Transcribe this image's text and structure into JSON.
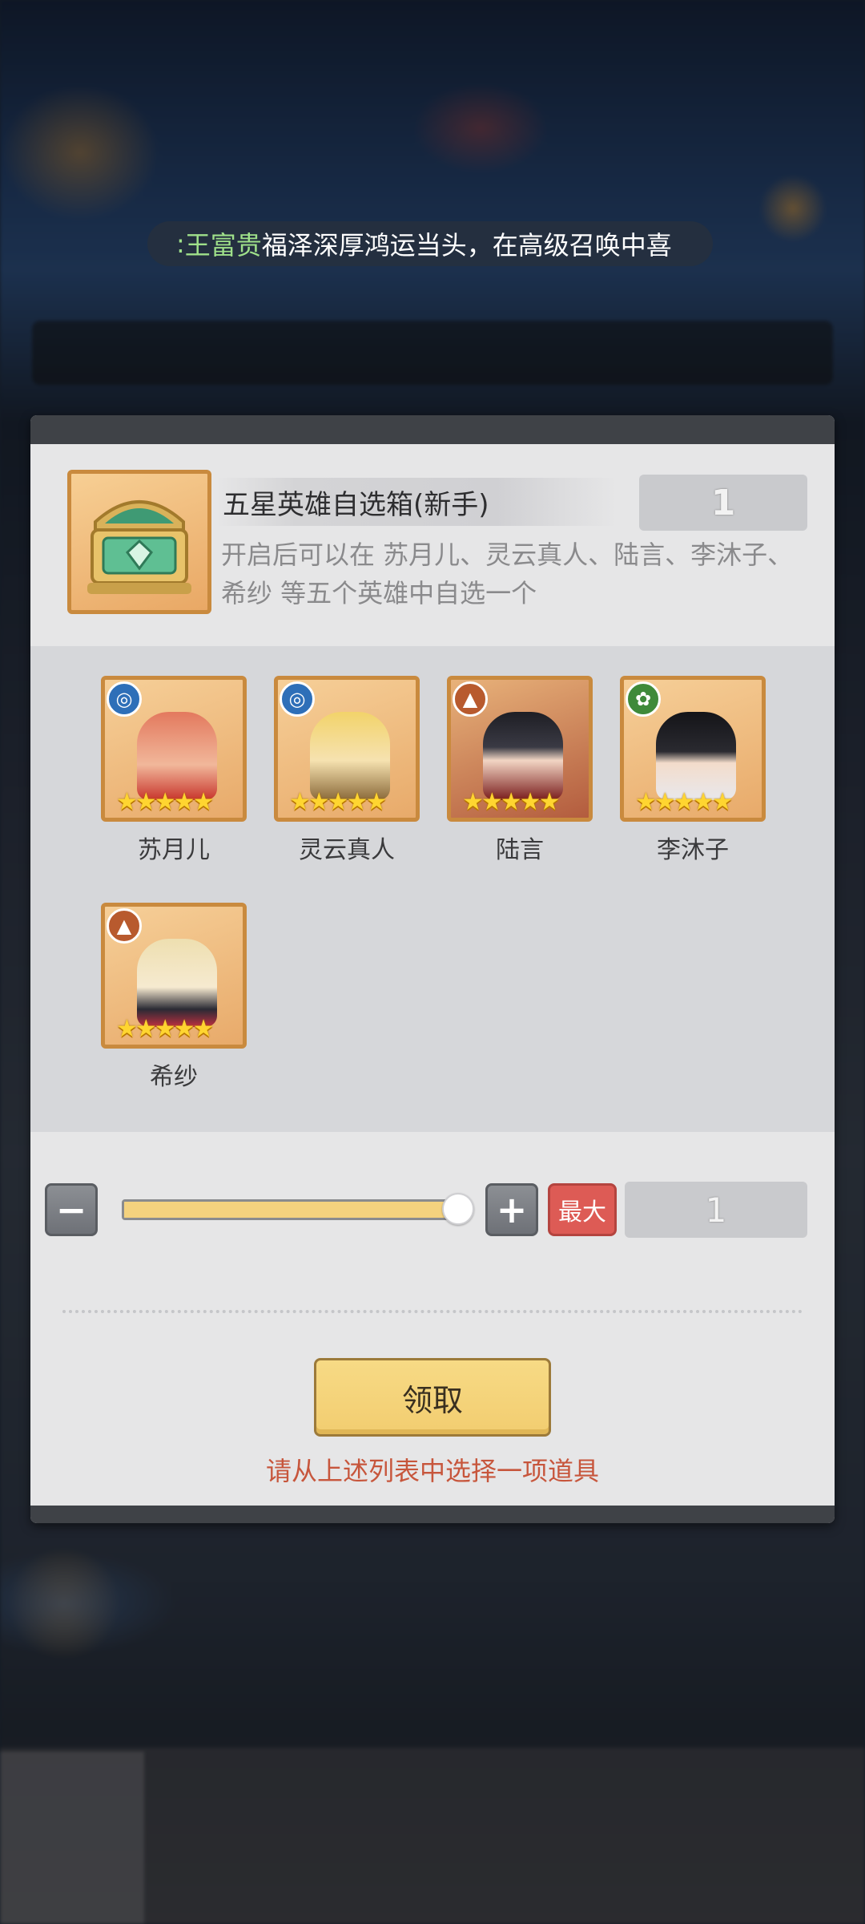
{
  "marquee": {
    "player_name": "王富贵",
    "message": "福泽深厚鸿运当头，在高级召唤中喜",
    "prefix": ":"
  },
  "item": {
    "title": "五星英雄自选箱(新手)",
    "owned_count": "1",
    "description": "开启后可以在 苏月儿、灵云真人、陆言、李沐子、希纱 等五个英雄中自选一个",
    "icon": "treasure-chest-icon"
  },
  "heroes": [
    {
      "name": "苏月儿",
      "element": "water",
      "stars": "★★★★★"
    },
    {
      "name": "灵云真人",
      "element": "water",
      "stars": "★★★★★"
    },
    {
      "name": "陆言",
      "element": "fire",
      "stars": "★★★★★"
    },
    {
      "name": "李沐子",
      "element": "wood",
      "stars": "★★★★★"
    },
    {
      "name": "希纱",
      "element": "fire",
      "stars": "★★★★★"
    }
  ],
  "quantity": {
    "minus_label": "−",
    "plus_label": "+",
    "max_label": "最大",
    "value": "1",
    "slider_fraction": 1.0
  },
  "claim_label": "领取",
  "hint": "请从上述列表中选择一项道具",
  "colors": {
    "accent_orange": "#c98a3e",
    "hint_red": "#c7563c",
    "button_gold": "#f2cd70",
    "max_red": "#dd5b55"
  }
}
